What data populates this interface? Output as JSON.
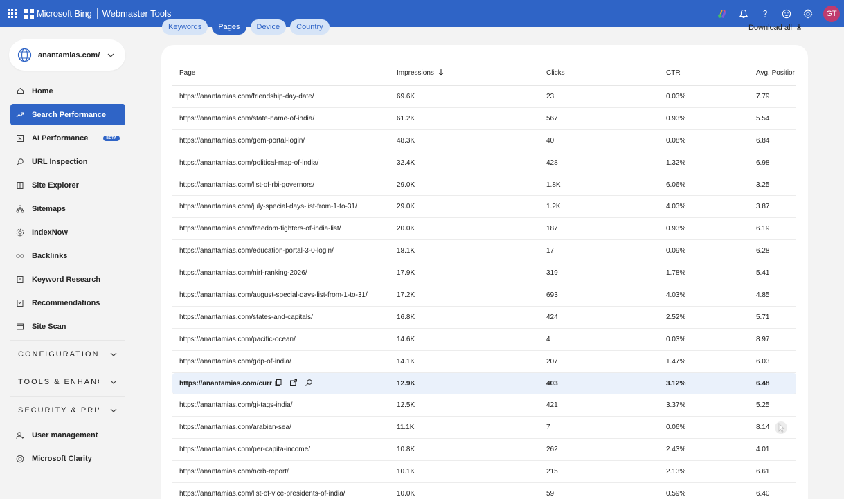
{
  "header": {
    "brand": "Microsoft Bing",
    "product": "Webmaster Tools",
    "avatar_initials": "GT",
    "icons": [
      "copilot-icon",
      "bell-icon",
      "help-icon",
      "feedback-icon",
      "settings-icon"
    ]
  },
  "tabs": [
    {
      "label": "Keywords",
      "active": false
    },
    {
      "label": "Pages",
      "active": true
    },
    {
      "label": "Device",
      "active": false
    },
    {
      "label": "Country",
      "active": false
    }
  ],
  "download_label": "Download all",
  "site": {
    "name": "anantamias.com/"
  },
  "sidebar": {
    "items": [
      {
        "label": "Home",
        "icon": "home-icon",
        "active": false
      },
      {
        "label": "Search Performance",
        "icon": "trend-icon",
        "active": true
      },
      {
        "label": "AI Performance",
        "icon": "ai-icon",
        "active": false,
        "badge": "BETA"
      },
      {
        "label": "URL Inspection",
        "icon": "inspect-icon",
        "active": false
      },
      {
        "label": "Site Explorer",
        "icon": "explorer-icon",
        "active": false
      },
      {
        "label": "Sitemaps",
        "icon": "sitemap-icon",
        "active": false
      },
      {
        "label": "IndexNow",
        "icon": "indexnow-icon",
        "active": false
      },
      {
        "label": "Backlinks",
        "icon": "link-icon",
        "active": false
      },
      {
        "label": "Keyword Research",
        "icon": "keyword-icon",
        "active": false
      },
      {
        "label": "Recommendations",
        "icon": "recommend-icon",
        "active": false
      },
      {
        "label": "Site Scan",
        "icon": "scan-icon",
        "active": false
      }
    ],
    "sections": [
      "CONFIGURATION",
      "TOOLS & ENHANCEMENTS",
      "SECURITY & PRIVACY"
    ],
    "bottom_items": [
      {
        "label": "User management",
        "icon": "user-icon"
      },
      {
        "label": "Microsoft Clarity",
        "icon": "clarity-icon"
      }
    ]
  },
  "table": {
    "columns": {
      "page": "Page",
      "impressions": "Impressions",
      "clicks": "Clicks",
      "ctr": "CTR",
      "position": "Avg. Position"
    },
    "rows": [
      {
        "page": "https://anantamias.com/friendship-day-date/",
        "impressions": "69.6K",
        "clicks": "23",
        "ctr": "0.03%",
        "position": "7.79"
      },
      {
        "page": "https://anantamias.com/state-name-of-india/",
        "impressions": "61.2K",
        "clicks": "567",
        "ctr": "0.93%",
        "position": "5.54"
      },
      {
        "page": "https://anantamias.com/gem-portal-login/",
        "impressions": "48.3K",
        "clicks": "40",
        "ctr": "0.08%",
        "position": "6.84"
      },
      {
        "page": "https://anantamias.com/political-map-of-india/",
        "impressions": "32.4K",
        "clicks": "428",
        "ctr": "1.32%",
        "position": "6.98"
      },
      {
        "page": "https://anantamias.com/list-of-rbi-governors/",
        "impressions": "29.0K",
        "clicks": "1.8K",
        "ctr": "6.06%",
        "position": "3.25"
      },
      {
        "page": "https://anantamias.com/july-special-days-list-from-1-to-31/",
        "impressions": "29.0K",
        "clicks": "1.2K",
        "ctr": "4.03%",
        "position": "3.87"
      },
      {
        "page": "https://anantamias.com/freedom-fighters-of-india-list/",
        "impressions": "20.0K",
        "clicks": "187",
        "ctr": "0.93%",
        "position": "6.19"
      },
      {
        "page": "https://anantamias.com/education-portal-3-0-login/",
        "impressions": "18.1K",
        "clicks": "17",
        "ctr": "0.09%",
        "position": "6.28"
      },
      {
        "page": "https://anantamias.com/nirf-ranking-2026/",
        "impressions": "17.9K",
        "clicks": "319",
        "ctr": "1.78%",
        "position": "5.41"
      },
      {
        "page": "https://anantamias.com/august-special-days-list-from-1-to-31/",
        "impressions": "17.2K",
        "clicks": "693",
        "ctr": "4.03%",
        "position": "4.85"
      },
      {
        "page": "https://anantamias.com/states-and-capitals/",
        "impressions": "16.8K",
        "clicks": "424",
        "ctr": "2.52%",
        "position": "5.71"
      },
      {
        "page": "https://anantamias.com/pacific-ocean/",
        "impressions": "14.6K",
        "clicks": "4",
        "ctr": "0.03%",
        "position": "8.97"
      },
      {
        "page": "https://anantamias.com/gdp-of-india/",
        "impressions": "14.1K",
        "clicks": "207",
        "ctr": "1.47%",
        "position": "6.03"
      },
      {
        "page": "https://anantamias.com/curr",
        "impressions": "12.9K",
        "clicks": "403",
        "ctr": "3.12%",
        "position": "6.48",
        "hover": true
      },
      {
        "page": "https://anantamias.com/gi-tags-india/",
        "impressions": "12.5K",
        "clicks": "421",
        "ctr": "3.37%",
        "position": "5.25"
      },
      {
        "page": "https://anantamias.com/arabian-sea/",
        "impressions": "11.1K",
        "clicks": "7",
        "ctr": "0.06%",
        "position": "8.14"
      },
      {
        "page": "https://anantamias.com/per-capita-income/",
        "impressions": "10.8K",
        "clicks": "262",
        "ctr": "2.43%",
        "position": "4.01"
      },
      {
        "page": "https://anantamias.com/ncrb-report/",
        "impressions": "10.1K",
        "clicks": "215",
        "ctr": "2.13%",
        "position": "6.61"
      },
      {
        "page": "https://anantamias.com/list-of-vice-presidents-of-india/",
        "impressions": "10.0K",
        "clicks": "59",
        "ctr": "0.59%",
        "position": "6.40"
      }
    ]
  }
}
